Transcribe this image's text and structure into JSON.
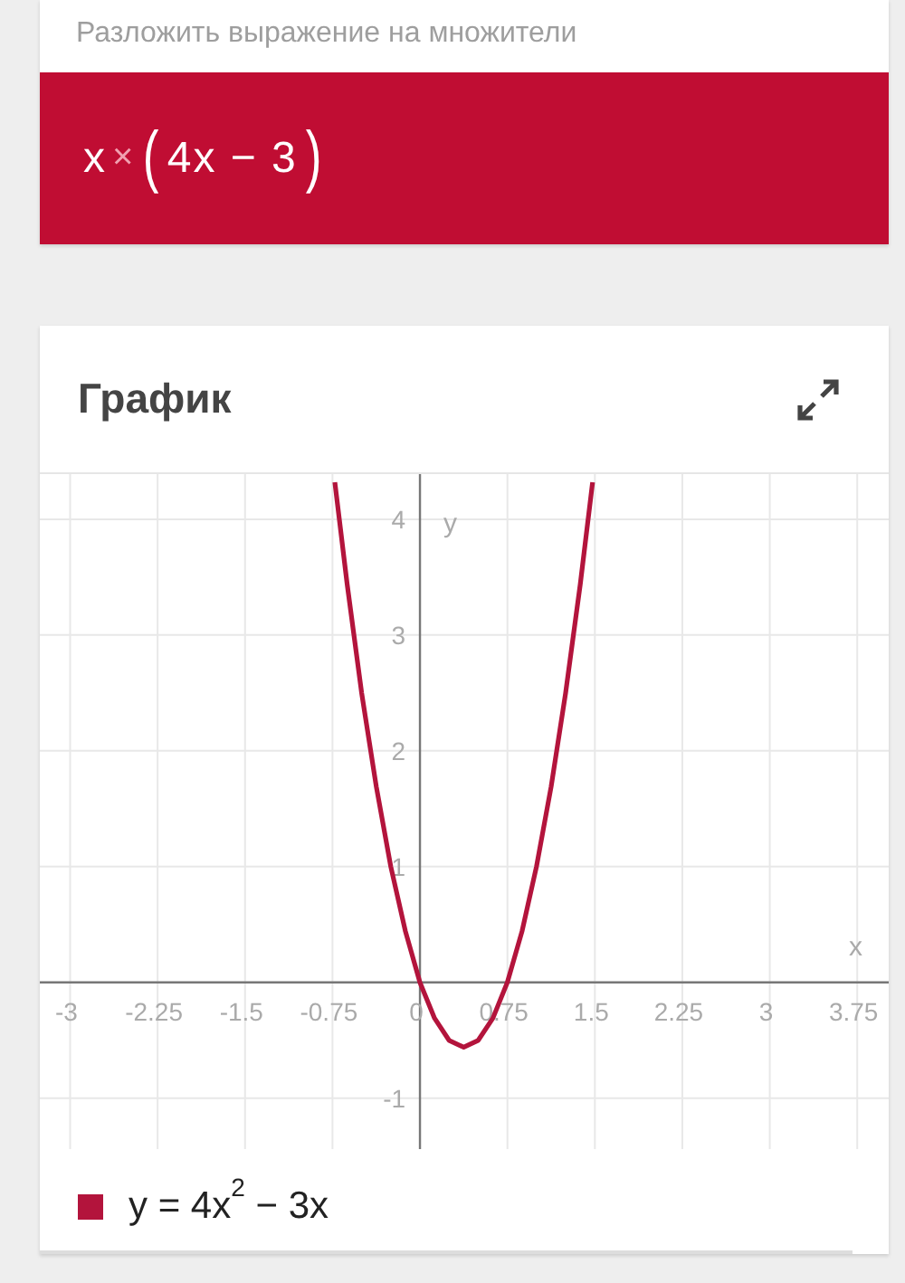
{
  "result_card": {
    "title": "Разложить выражение на множители",
    "tokens": [
      {
        "kind": "term",
        "text": "x"
      },
      {
        "kind": "operator",
        "text": "×"
      },
      {
        "kind": "paren",
        "text": "("
      },
      {
        "kind": "term",
        "text": "4x − 3"
      },
      {
        "kind": "paren",
        "text": ")"
      }
    ]
  },
  "graph_card": {
    "title": "График",
    "chart_data": {
      "type": "line",
      "xlabel": "x",
      "ylabel": "y",
      "xlim": [
        -3.26,
        4.02
      ],
      "ylim": [
        -1.44,
        4.39
      ],
      "xticks": [
        -3,
        -2.25,
        -1.5,
        -0.75,
        0,
        0.75,
        1.5,
        2.25,
        3,
        3.75
      ],
      "yticks": [
        -1,
        1,
        2,
        3,
        4
      ],
      "grid": true,
      "x": [
        -0.73,
        -0.625,
        -0.5,
        -0.375,
        -0.25,
        -0.125,
        0,
        0.125,
        0.25,
        0.375,
        0.5,
        0.625,
        0.75,
        0.875,
        1,
        1.125,
        1.25,
        1.375,
        1.48
      ],
      "series": [
        {
          "name": "y = 4x$^{2}$ − 3x",
          "color": "#b3143c",
          "values": [
            4.32,
            3.44,
            2.5,
            1.69,
            1,
            0.44,
            0,
            -0.31,
            -0.5,
            -0.56,
            -0.5,
            -0.31,
            0,
            0.44,
            1,
            1.69,
            2.5,
            3.44,
            4.32
          ]
        }
      ]
    }
  }
}
